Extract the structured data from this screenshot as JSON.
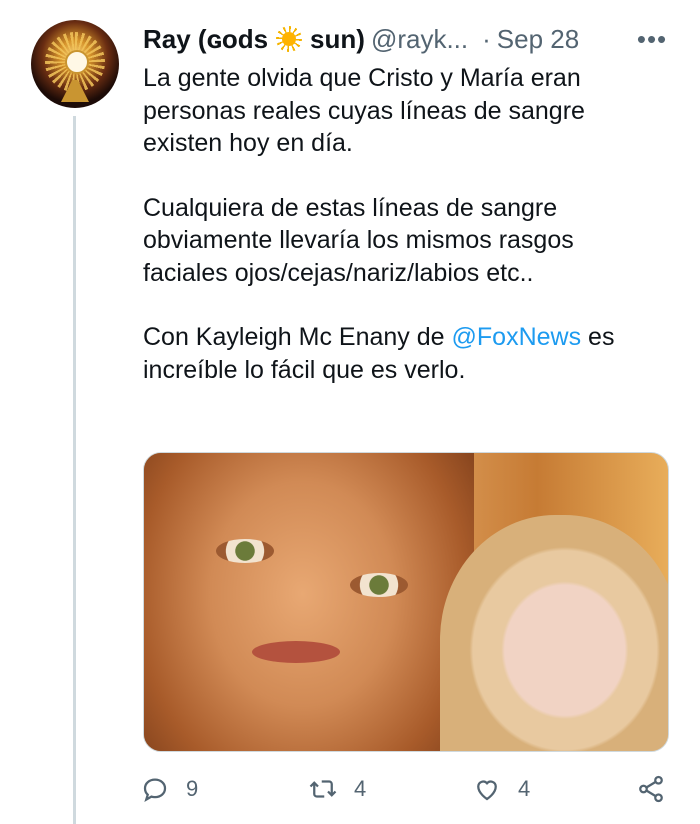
{
  "tweet": {
    "display_name_pre": "Ray (ɢods",
    "display_name_post": "sun)",
    "handle": "@rayk...",
    "separator": "·",
    "date": "Sep 28",
    "more_label": "•••",
    "paragraphs": [
      "La gente olvida que Cristo y María eran personas reales cuyas líneas de sangre existen hoy en día.",
      "Cualquiera de estas líneas de sangre obviamente llevaría los mismos rasgos faciales ojos/cejas/nariz/labios etc..",
      null
    ],
    "p3_before": "Con Kayleigh Mc Enany de ",
    "p3_mention": "@FoxNews",
    "p3_after": " es increíble lo fácil que es verlo."
  },
  "actions": {
    "reply_count": "9",
    "retweet_count": "4",
    "like_count": "4"
  },
  "icons": [
    "avatar-monstrance",
    "sun-icon",
    "more-icon",
    "reply-icon",
    "retweet-icon",
    "like-icon",
    "share-icon"
  ],
  "colors": {
    "text": "#0f1419",
    "secondary": "#536471",
    "link": "#1d9bf0",
    "thread_line": "#cfd9de"
  }
}
